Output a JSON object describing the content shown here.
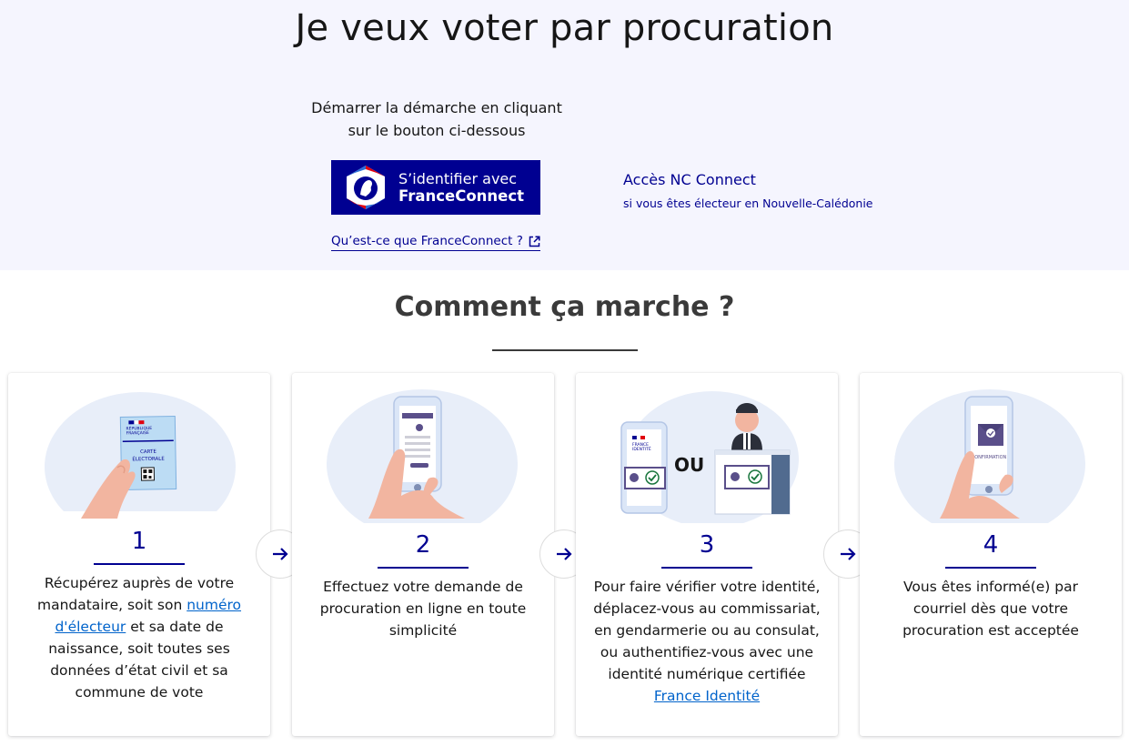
{
  "hero": {
    "title": "Je veux voter par procuration",
    "intro_line1": "Démarrer la démarche en cliquant",
    "intro_line2": "sur le bouton ci-dessous",
    "franceconnect_line1": "S’identifier avec",
    "franceconnect_line2": "FranceConnect",
    "franceconnect_help": "Qu’est-ce que FranceConnect ?",
    "nc_title": "Accès NC Connect",
    "nc_subtitle": "si vous êtes électeur en Nouvelle-Calédonie"
  },
  "how": {
    "title": "Comment ça marche ?"
  },
  "illustrations": {
    "card1": {
      "republique": "RÉPUBLIQUE",
      "francaise": "FRANÇAISE",
      "carte": "CARTE",
      "electorale": "ÉLECTORALE"
    },
    "card3": {
      "ou": "OU",
      "france": "FRANCE",
      "identite": "IDENTITÉ"
    },
    "card4": {
      "confirmation": "CONFIRMATION"
    }
  },
  "steps": [
    {
      "number": "1",
      "text_before": "Récupérez auprès de votre mandataire, soit son ",
      "link": "numéro d'électeur",
      "text_after": " et sa date de naissance, soit toutes ses données d’état civil et sa commune de vote"
    },
    {
      "number": "2",
      "text": "Effectuez votre demande de procuration en ligne en toute simplicité"
    },
    {
      "number": "3",
      "text": "Pour faire vérifier votre identité, déplacez-vous au commissariat, en gendarmerie ou au consulat, ou authentifiez-vous avec une identité numérique certifiée",
      "link": "France Identité"
    },
    {
      "number": "4",
      "text": "Vous êtes informé(e) par courriel dès que votre procuration est acceptée"
    }
  ],
  "colors": {
    "primary": "#000091",
    "link": "#0063cb",
    "hero_bg": "#f5f5fe",
    "illustration_blob": "#e8eef9",
    "skin": "#f2b5a0",
    "check_green": "#18753c"
  }
}
